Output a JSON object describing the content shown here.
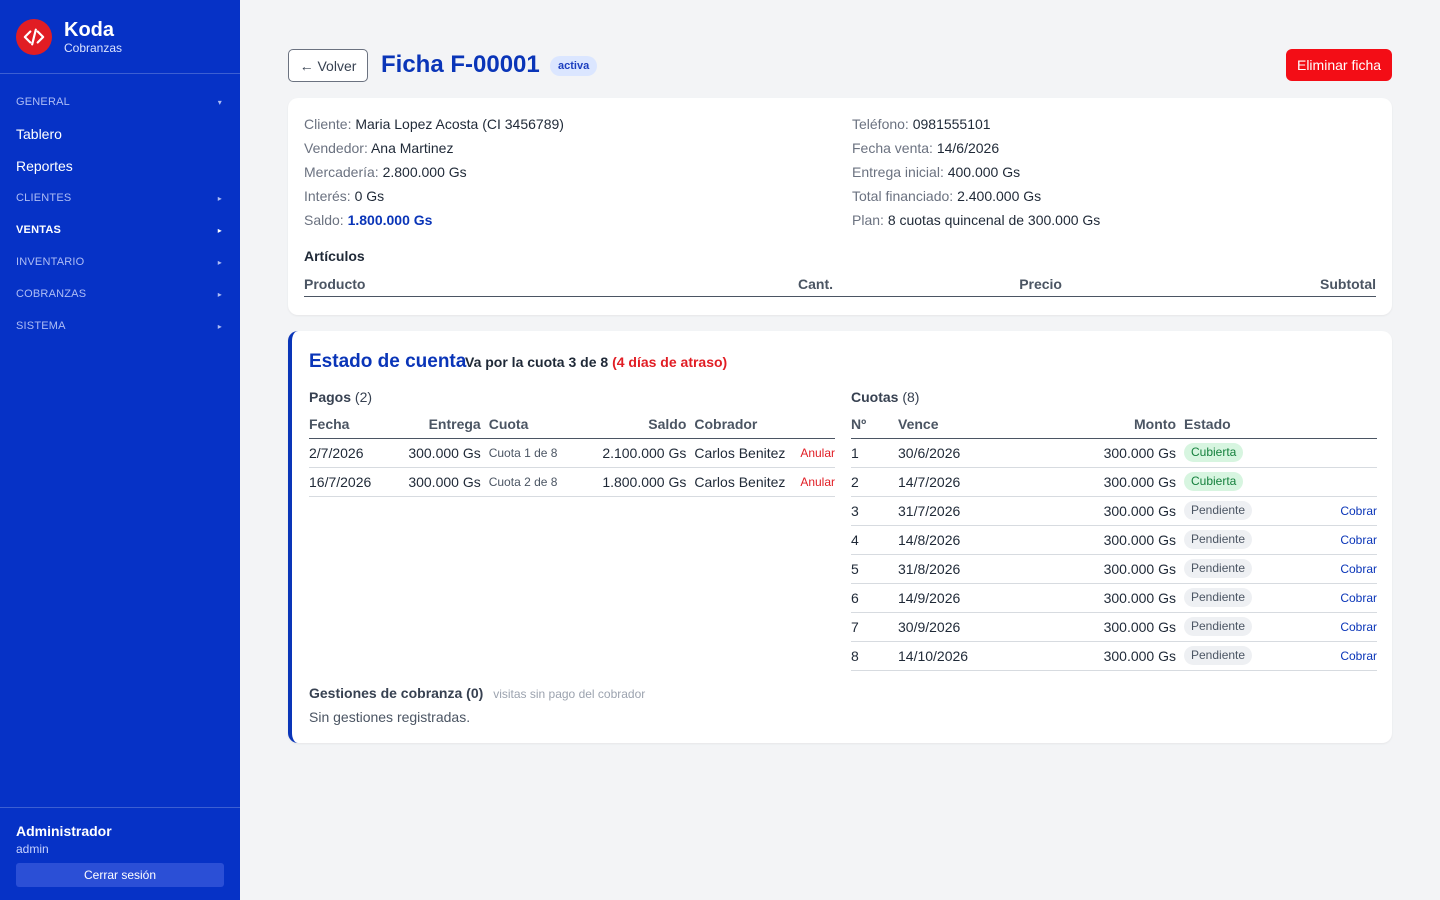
{
  "brand": {
    "name": "Koda",
    "subtitle": "Cobranzas"
  },
  "sidebar": {
    "items": [
      {
        "type": "section",
        "label": "GENERAL",
        "caret": "▾"
      },
      {
        "type": "link",
        "label": "Tablero"
      },
      {
        "type": "link",
        "label": "Reportes"
      },
      {
        "type": "section",
        "label": "CLIENTES",
        "caret": "▸"
      },
      {
        "type": "section",
        "label": "VENTAS",
        "caret": "▸",
        "active": true
      },
      {
        "type": "section",
        "label": "INVENTARIO",
        "caret": "▸"
      },
      {
        "type": "section",
        "label": "COBRANZAS",
        "caret": "▸"
      },
      {
        "type": "section",
        "label": "SISTEMA",
        "caret": "▸"
      }
    ],
    "user": {
      "name": "Administrador",
      "role": "admin"
    },
    "logout_label": "Cerrar sesión"
  },
  "header": {
    "back_label": "← Volver",
    "title": "Ficha F-00001",
    "status_badge": "activa",
    "delete_label": "Eliminar ficha"
  },
  "ficha": {
    "left": [
      {
        "key": "Cliente:",
        "value": "Maria Lopez Acosta (CI 3456789)"
      },
      {
        "key": "Vendedor:",
        "value": "Ana Martinez"
      },
      {
        "key": "Mercadería:",
        "value": "2.800.000 Gs"
      },
      {
        "key": "Interés:",
        "value": "0 Gs"
      },
      {
        "key": "Saldo:",
        "value": "1.800.000 Gs",
        "emphasis": true
      }
    ],
    "right": [
      {
        "key": "Teléfono:",
        "value": "0981555101"
      },
      {
        "key": "Fecha venta:",
        "value": "14/6/2026"
      },
      {
        "key": "Entrega inicial:",
        "value": "400.000 Gs"
      },
      {
        "key": "Total financiado:",
        "value": "2.400.000 Gs"
      },
      {
        "key": "Plan:",
        "value": "8 cuotas quincenal de 300.000 Gs"
      }
    ],
    "articulos_title": "Artículos",
    "articulos_columns": [
      "Producto",
      "Cant.",
      "Precio",
      "Subtotal"
    ]
  },
  "cuenta": {
    "title": "Estado de cuenta",
    "status_text": "Va por la cuota 3 de 8",
    "atraso_text": "(4 días de atraso)",
    "pagos": {
      "title": "Pagos",
      "count": "(2)",
      "columns": [
        "Fecha",
        "Entrega",
        "Cuota",
        "Saldo",
        "Cobrador"
      ],
      "rows": [
        {
          "fecha": "2/7/2026",
          "entrega": "300.000 Gs",
          "cuota": "Cuota 1 de 8",
          "saldo": "2.100.000 Gs",
          "cobrador": "Carlos Benitez",
          "action": "Anular"
        },
        {
          "fecha": "16/7/2026",
          "entrega": "300.000 Gs",
          "cuota": "Cuota 2 de 8",
          "saldo": "1.800.000 Gs",
          "cobrador": "Carlos Benitez",
          "action": "Anular"
        }
      ]
    },
    "cuotas": {
      "title": "Cuotas",
      "count": "(8)",
      "columns": [
        "Nº",
        "Vence",
        "Monto",
        "Estado"
      ],
      "rows": [
        {
          "n": "1",
          "vence": "30/6/2026",
          "monto": "300.000 Gs",
          "estado": "Cubierta",
          "action": ""
        },
        {
          "n": "2",
          "vence": "14/7/2026",
          "monto": "300.000 Gs",
          "estado": "Cubierta",
          "action": ""
        },
        {
          "n": "3",
          "vence": "31/7/2026",
          "monto": "300.000 Gs",
          "estado": "Pendiente",
          "action": "Cobrar"
        },
        {
          "n": "4",
          "vence": "14/8/2026",
          "monto": "300.000 Gs",
          "estado": "Pendiente",
          "action": "Cobrar"
        },
        {
          "n": "5",
          "vence": "31/8/2026",
          "monto": "300.000 Gs",
          "estado": "Pendiente",
          "action": "Cobrar"
        },
        {
          "n": "6",
          "vence": "14/9/2026",
          "monto": "300.000 Gs",
          "estado": "Pendiente",
          "action": "Cobrar"
        },
        {
          "n": "7",
          "vence": "30/9/2026",
          "monto": "300.000 Gs",
          "estado": "Pendiente",
          "action": "Cobrar"
        },
        {
          "n": "8",
          "vence": "14/10/2026",
          "monto": "300.000 Gs",
          "estado": "Pendiente",
          "action": "Cobrar"
        }
      ]
    },
    "gestiones": {
      "title": "Gestiones de cobranza",
      "count": "(0)",
      "hint": "visitas sin pago del cobrador",
      "empty": "Sin gestiones registradas."
    }
  }
}
